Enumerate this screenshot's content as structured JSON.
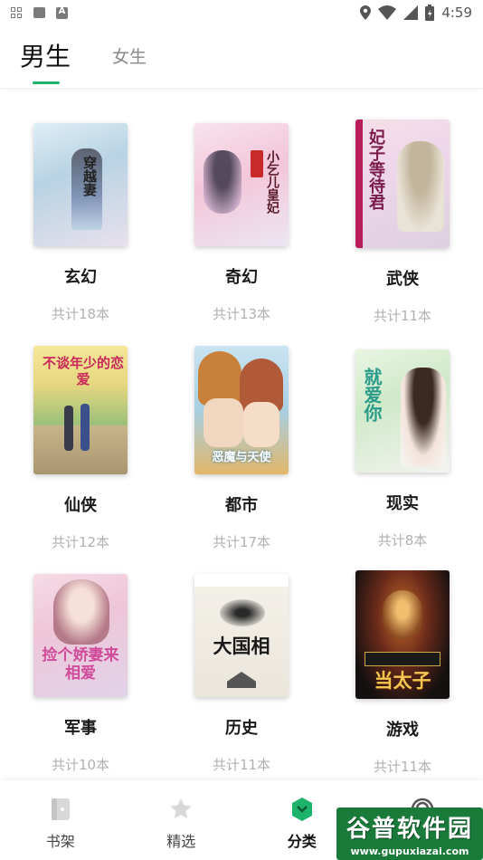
{
  "status_bar": {
    "time": "4:59",
    "left_icons": [
      "grid-icon",
      "app-icon",
      "text-a-icon"
    ],
    "right_icons": [
      "location-icon",
      "wifi-icon",
      "signal-icon",
      "battery-icon"
    ]
  },
  "tabs": [
    {
      "label": "男生",
      "active": true
    },
    {
      "label": "女生",
      "active": false
    }
  ],
  "accent_color": "#1db36a",
  "categories": [
    {
      "name": "玄幻",
      "count": "共计18本",
      "cover_title": "穿越妻"
    },
    {
      "name": "奇幻",
      "count": "共计13本",
      "cover_title": "小乞儿皇妃"
    },
    {
      "name": "武侠",
      "count": "共计11本",
      "cover_title": "妃子等待君"
    },
    {
      "name": "仙侠",
      "count": "共计12本",
      "cover_title": "不谈年少的恋爱"
    },
    {
      "name": "都市",
      "count": "共计17本",
      "cover_title": "恶魔与天使"
    },
    {
      "name": "现实",
      "count": "共计8本",
      "cover_title": "就爱你"
    },
    {
      "name": "军事",
      "count": "共计10本",
      "cover_title": "捡个娇妻来相爱"
    },
    {
      "name": "历史",
      "count": "共计11本",
      "cover_title": "大国相"
    },
    {
      "name": "游戏",
      "count": "共计11本",
      "cover_title": "当太子"
    }
  ],
  "bottom_nav": [
    {
      "label": "书架",
      "icon": "bookshelf-icon",
      "active": false
    },
    {
      "label": "精选",
      "icon": "star-icon",
      "active": false
    },
    {
      "label": "分类",
      "icon": "category-icon",
      "active": true
    },
    {
      "label": "",
      "icon": "profile-icon",
      "active": false
    }
  ],
  "watermark": {
    "text": "谷普软件园",
    "url": "www.gupuxiazai.com"
  }
}
